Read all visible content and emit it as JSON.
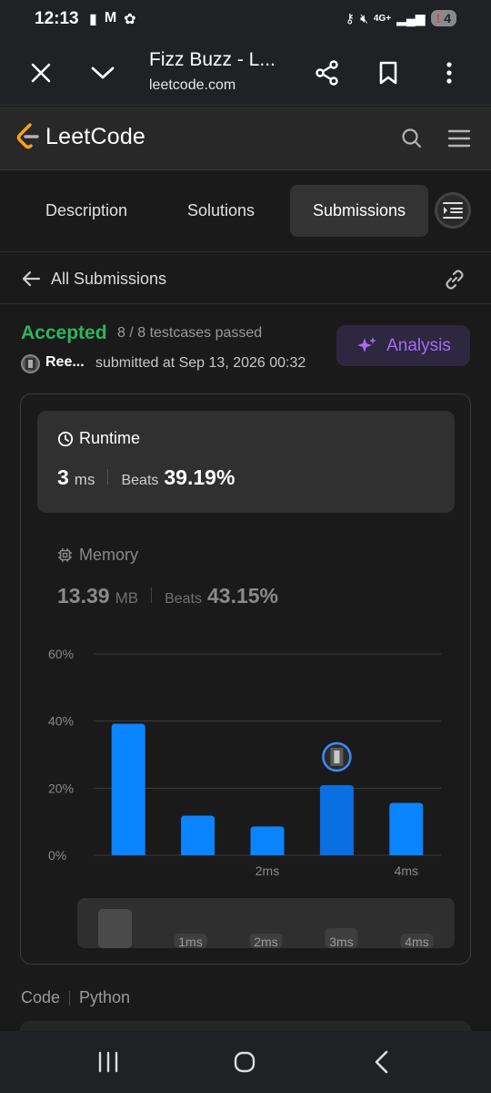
{
  "status_bar": {
    "time": "12:13",
    "battery_count": "4",
    "network": "4G+"
  },
  "browser": {
    "title": "Fizz Buzz - L...",
    "url": "leetcode.com"
  },
  "header": {
    "logo_text": "LeetCode"
  },
  "tabs": [
    {
      "label": "Description",
      "active": false
    },
    {
      "label": "Solutions",
      "active": false
    },
    {
      "label": "Submissions",
      "active": true
    }
  ],
  "all_submissions": {
    "label": "All Submissions"
  },
  "submission": {
    "status": "Accepted",
    "testcases": "8 / 8 testcases passed",
    "user_name": "Ree...",
    "submitted_at": "submitted at Sep 13, 2026 00:32",
    "analysis_label": "Analysis"
  },
  "runtime": {
    "title": "Runtime",
    "value": "3",
    "unit": "ms",
    "beats_label": "Beats",
    "beats_value": "39.19%"
  },
  "memory": {
    "title": "Memory",
    "value": "13.39",
    "unit": "MB",
    "beats_label": "Beats",
    "beats_value": "43.15%"
  },
  "chart_data": {
    "type": "bar",
    "categories": [
      "",
      "",
      "2ms",
      "",
      "4ms"
    ],
    "values": [
      39.2,
      11.8,
      8.6,
      20.9,
      15.6
    ],
    "highlight_index": 3,
    "y_ticks": [
      "0%",
      "20%",
      "40%",
      "60%"
    ],
    "ylim": [
      0,
      60
    ],
    "grid": true,
    "bar_color": "#0a84ff",
    "highlight_color": "#0a6fe0",
    "minimap_labels": [
      "",
      "1ms",
      "2ms",
      "3ms",
      "4ms"
    ]
  },
  "code": {
    "label": "Code",
    "language": "Python"
  },
  "colors": {
    "accepted": "#2db55d",
    "analysis": "#a56cf3",
    "logo_orange": "#ffa116"
  },
  "icons": {
    "close": "close-icon",
    "chevron": "chevron-down-icon",
    "share": "share-icon",
    "bookmark": "bookmark-icon",
    "more": "more-vertical-icon",
    "search": "search-icon",
    "menu": "hamburger-menu-icon",
    "back": "arrow-left-icon",
    "link": "link-icon",
    "clock": "clock-icon",
    "chip": "chip-icon",
    "sparkle": "sparkle-icon"
  }
}
